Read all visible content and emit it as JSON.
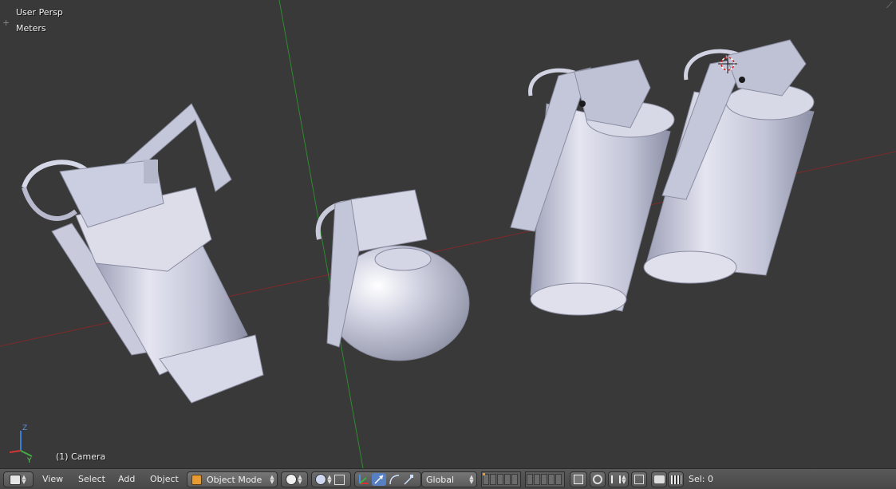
{
  "viewport": {
    "projection_label": "User Persp",
    "units_label": "Meters",
    "object_info": "(1) Camera",
    "colors": {
      "background": "#393939",
      "x_axis": "#8a2b2b",
      "y_axis": "#2e8a2e",
      "mesh": "#c9cbdd"
    }
  },
  "header": {
    "menus": [
      "View",
      "Select",
      "Add",
      "Object"
    ],
    "mode": "Object Mode",
    "orientation": "Global",
    "selection_count": "Sel: 0"
  }
}
